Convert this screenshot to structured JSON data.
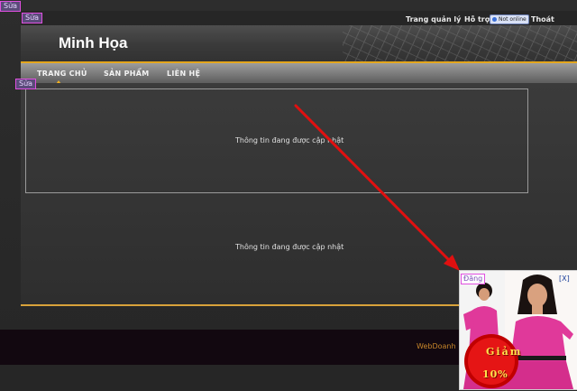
{
  "edit_tags": [
    "Sửa",
    "Sửa",
    "Sửa"
  ],
  "topbar": {
    "admin_link": "Trang quản lý",
    "support_link": "Hỗ trợ",
    "status_badge": "Not online",
    "logout_link": "Thoát"
  },
  "header": {
    "site_title": "Minh Họa"
  },
  "nav": {
    "items": [
      {
        "label": "TRANG CHỦ"
      },
      {
        "label": "SẢN PHẨM"
      },
      {
        "label": "LIÊN HỆ"
      }
    ]
  },
  "content": {
    "box1_text": "Thông tin đang được cập nhật",
    "box2_text": "Thông tin đang được cập nhật"
  },
  "footer": {
    "text": "WebDoanh"
  },
  "ad": {
    "label": "Đăng",
    "close": "[X]",
    "promo_line1": "Giảm",
    "promo_line2": "10%"
  },
  "colors": {
    "accent_gold": "#e3a61d",
    "arrow_red": "#e01010",
    "ad_pink": "#e0399a"
  }
}
